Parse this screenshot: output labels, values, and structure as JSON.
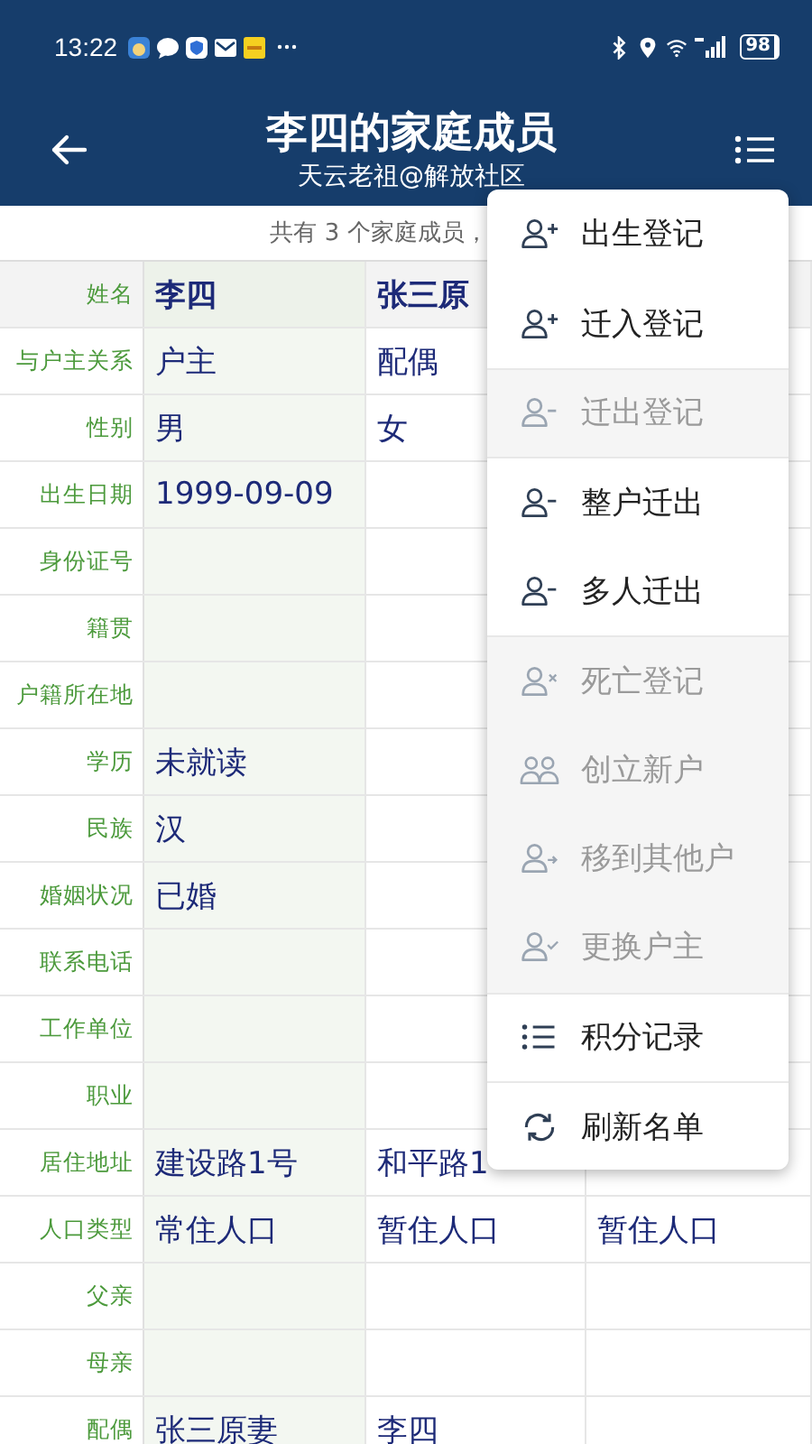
{
  "status_bar": {
    "time": "13:22",
    "battery": "98"
  },
  "header": {
    "title": "李四的家庭成员",
    "subtitle": "天云老祖@解放社区"
  },
  "summary": "共有 3 个家庭成员，",
  "table": {
    "rows": [
      {
        "kind": "name",
        "label": "姓名",
        "col_1": "李四",
        "col_2": "张三原"
      },
      {
        "kind": "field",
        "label": "与户主关系",
        "col_1": "户主",
        "col_2": "配偶"
      },
      {
        "kind": "field",
        "label": "性别",
        "col_1": "男",
        "col_2": "女"
      },
      {
        "kind": "field",
        "label": "出生日期",
        "col_1": "1999-09-09"
      },
      {
        "kind": "field",
        "label": "身份证号"
      },
      {
        "kind": "field",
        "label": "籍贯"
      },
      {
        "kind": "field",
        "label": "户籍所在地"
      },
      {
        "kind": "field",
        "label": "学历",
        "col_1": "未就读"
      },
      {
        "kind": "field",
        "label": "民族",
        "col_1": "汉"
      },
      {
        "kind": "field",
        "label": "婚姻状况",
        "col_1": "已婚"
      },
      {
        "kind": "field",
        "label": "联系电话"
      },
      {
        "kind": "field",
        "label": "工作单位"
      },
      {
        "kind": "field",
        "label": "职业"
      },
      {
        "kind": "field",
        "label": "居住地址",
        "col_1": "建设路1号",
        "col_2": "和平路1"
      },
      {
        "kind": "field",
        "label": "人口类型",
        "col_1": "常住人口",
        "col_2": "暂住人口",
        "col_3": "暂住人口"
      },
      {
        "kind": "field",
        "label": "父亲"
      },
      {
        "kind": "field",
        "label": "母亲"
      },
      {
        "kind": "field",
        "label": "配偶",
        "col_1": "张三原妻",
        "col_2": "李四"
      }
    ]
  },
  "menu": [
    {
      "label": "出生登记",
      "kind": "person-plus",
      "disabled": false
    },
    {
      "label": "迁入登记",
      "kind": "person-plus",
      "disabled": false
    },
    {
      "label": "迁出登记",
      "kind": "person-minus",
      "disabled": true
    },
    {
      "label": "整户迁出",
      "kind": "person-minus",
      "disabled": false
    },
    {
      "label": "多人迁出",
      "kind": "person-minus",
      "disabled": false
    },
    {
      "label": "死亡登记",
      "kind": "person-x",
      "disabled": true
    },
    {
      "label": "创立新户",
      "kind": "people",
      "disabled": true
    },
    {
      "label": "移到其他户",
      "kind": "person-arrow",
      "disabled": true
    },
    {
      "label": "更换户主",
      "kind": "person-check",
      "disabled": true
    },
    {
      "label": "积分记录",
      "kind": "list",
      "disabled": false
    },
    {
      "label": "刷新名单",
      "kind": "refresh",
      "disabled": false
    }
  ]
}
